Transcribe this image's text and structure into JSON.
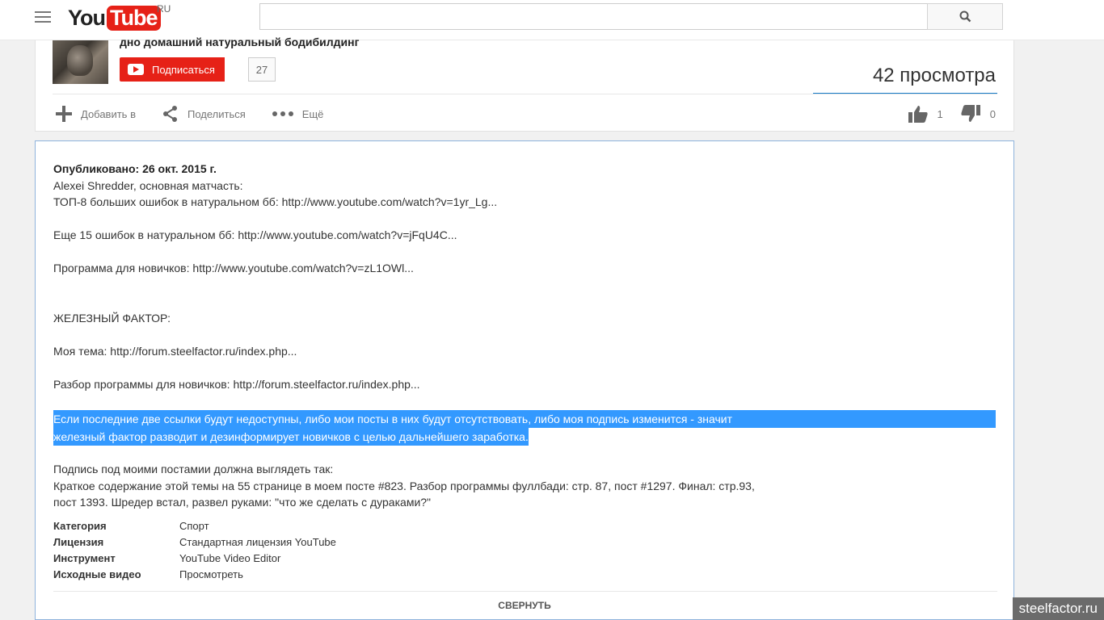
{
  "header": {
    "logo_you": "You",
    "logo_tube": "Tube",
    "region": "RU",
    "search_placeholder": ""
  },
  "channel": {
    "name": "дно домашний натуральный бодибилдинг",
    "subscribe_label": "Подписаться",
    "subscriber_count": "27",
    "views": "42 просмотра"
  },
  "actions": {
    "add_to": "Добавить в",
    "share": "Поделиться",
    "more": "Ещё",
    "likes": "1",
    "dislikes": "0"
  },
  "description": {
    "published": "Опубликовано: 26 окт. 2015 г.",
    "lines": [
      "Alexei Shredder, основная матчасть:",
      "ТОП-8 больших ошибок в натуральном бб: http://www.youtube.com/watch?v=1yr_Lg...",
      "Еще 15 ошибок в натуральном бб: http://www.youtube.com/watch?v=jFqU4C...",
      "Программа для новичков: http://www.youtube.com/watch?v=zL1OWl...",
      "ЖЕЛЕЗНЫЙ ФАКТОР:",
      "Моя тема: http://forum.steelfactor.ru/index.php...",
      "Разбор программы для новичков: http://forum.steelfactor.ru/index.php..."
    ],
    "highlight_1": "Если последние две ссылки будут недоступны, либо мои посты в них будут отсутствовать, либо моя подпись изменится - значит",
    "highlight_2": "железный фактор разводит и дезинформирует новичков с целью дальнейшего заработка.",
    "signature_intro": "Подпись под моими постамии должна выглядеть так:",
    "signature_1": "Краткое содержание этой темы на 55 странице в моем посте #823. Разбор программы фуллбади: стр. 87, пост #1297. Финал: стр.93,",
    "signature_2": "пост 1393. Шредер встал, развел руками: \"что же сделать с дураками?\""
  },
  "meta": [
    {
      "key": "Категория",
      "value": "Спорт"
    },
    {
      "key": "Лицензия",
      "value": "Стандартная лицензия YouTube"
    },
    {
      "key": "Инструмент",
      "value": "YouTube Video Editor"
    },
    {
      "key": "Исходные видео",
      "value": "Просмотреть"
    }
  ],
  "collapse_label": "СВЕРНУТЬ",
  "watermark": "steelfactor.ru",
  "colors": {
    "brand_red": "#e62117",
    "accent_blue": "#167ac6",
    "selection": "#3399ff"
  }
}
